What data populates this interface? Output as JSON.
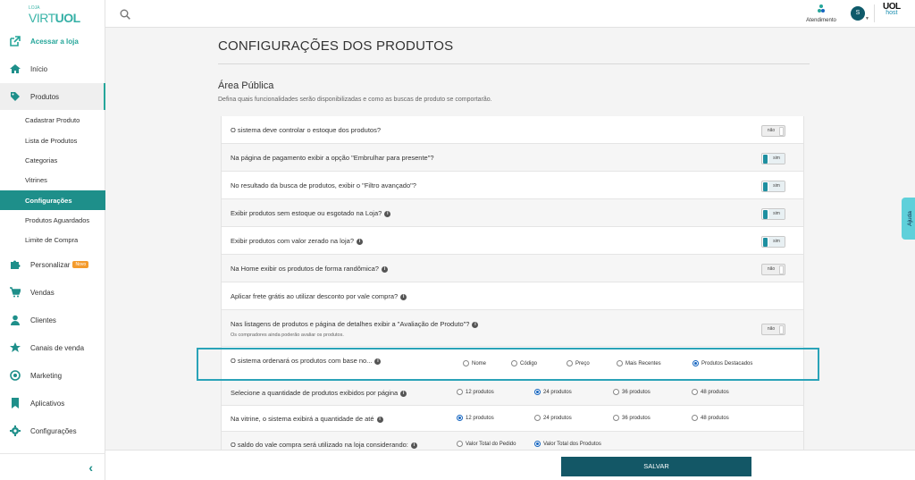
{
  "logo": {
    "small": "LOJA",
    "virt": "VIRT",
    "uol": "UOL"
  },
  "sidebar": {
    "items": [
      {
        "label": "Acessar a loja",
        "icon": "external-link-icon"
      },
      {
        "label": "Início",
        "icon": "home-icon"
      },
      {
        "label": "Produtos",
        "icon": "tag-icon"
      },
      {
        "label": "Personalizar",
        "icon": "puzzle-icon",
        "badge": "Novo"
      },
      {
        "label": "Vendas",
        "icon": "cart-icon"
      },
      {
        "label": "Clientes",
        "icon": "user-icon"
      },
      {
        "label": "Canais de venda",
        "icon": "star-icon"
      },
      {
        "label": "Marketing",
        "icon": "target-icon"
      },
      {
        "label": "Aplicativos",
        "icon": "bookmark-icon"
      },
      {
        "label": "Configurações",
        "icon": "gear-icon"
      }
    ],
    "subitems": [
      "Cadastrar Produto",
      "Lista de Produtos",
      "Categorias",
      "Vitrines",
      "Configurações",
      "Produtos Aguardados",
      "Limite de Compra"
    ],
    "active_sub": "Configurações",
    "collapse": "‹"
  },
  "topbar": {
    "atendimento": "Atendimento",
    "avatar": "S",
    "uol_top": "UOL",
    "uol_bottom": "host"
  },
  "page": {
    "title": "CONFIGURAÇÕES DOS PRODUTOS",
    "section": "Área Pública",
    "section_desc": "Defina quais funcionalidades serão disponibilizadas e como as buscas de produto se comportarão."
  },
  "settings": [
    {
      "q": "O sistema deve controlar o estoque dos produtos?",
      "toggle": "não",
      "on": false
    },
    {
      "q": "Na página de pagamento exibir a opção \"Embrulhar para presente\"?",
      "toggle": "sim",
      "on": true
    },
    {
      "q": "No resultado da busca de produtos, exibir o \"Filtro avançado\"?",
      "toggle": "sim",
      "on": true
    },
    {
      "q": "Exibir produtos sem estoque ou esgotado na Loja?",
      "toggle": "sim",
      "on": true
    },
    {
      "q": "Exibir produtos com valor zerado na loja?",
      "toggle": "sim",
      "on": true
    },
    {
      "q": "Na Home exibir os produtos de forma randômica?",
      "toggle": "não",
      "on": false
    },
    {
      "q": "Aplicar frete grátis ao utilizar desconto por vale compra?"
    },
    {
      "q": "Nas listagens de produtos e página de detalhes exibir a \"Avaliação de Produto\"?",
      "toggle": "não",
      "on": false,
      "note": "Os compradores ainda poderão avaliar os produtos."
    }
  ],
  "radios": {
    "ordem": {
      "q": "O sistema ordenará os produtos com base no...",
      "options": [
        "Nome",
        "Código",
        "Preço",
        "Mais Recentes",
        "Produtos Destacados"
      ],
      "selected": 4
    },
    "quantidade": {
      "q": "Selecione a quantidade de produtos exibidos por página",
      "options": [
        "12 produtos",
        "24 produtos",
        "36 produtos",
        "48 produtos"
      ],
      "selected": 1
    },
    "vitrine": {
      "q": "Na vitrine, o sistema exibirá a quantidade de até",
      "options": [
        "12 produtos",
        "24 produtos",
        "36 produtos",
        "48 produtos"
      ],
      "selected": 0
    },
    "vale": {
      "q": "O saldo do vale compra será utilizado na loja considerando:",
      "options": [
        "Valor Total do Pedido",
        "Valor Total dos Produtos"
      ],
      "selected": 1
    }
  },
  "save_label": "SALVAR",
  "help_label": "Ajuda"
}
